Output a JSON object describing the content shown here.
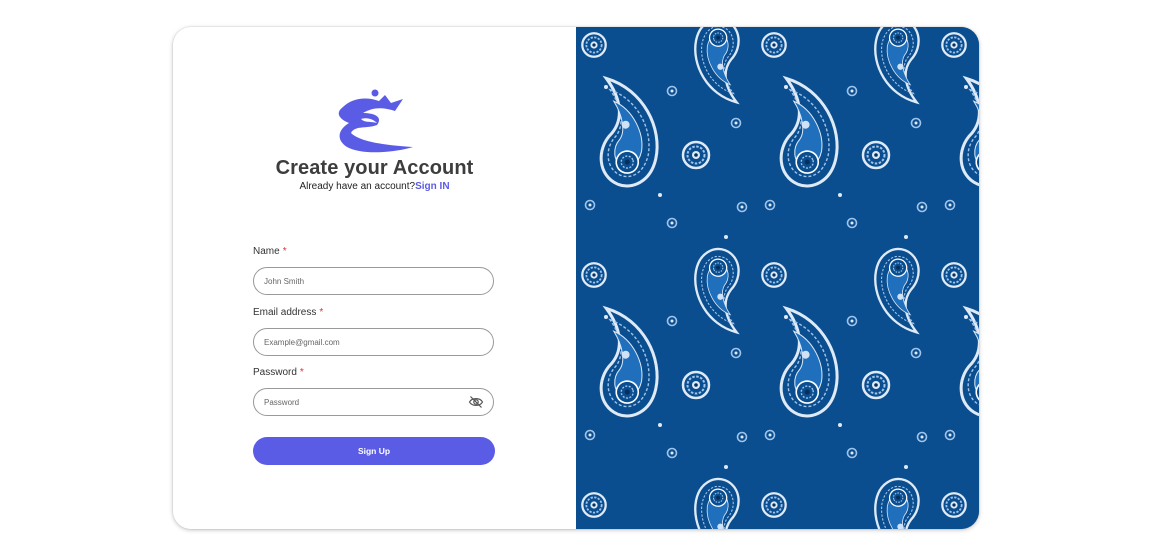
{
  "signup": {
    "title": "Create your Account",
    "subtitle_text": "Already have an account?",
    "signin_link": "Sign IN",
    "fields": {
      "name": {
        "label": "Name",
        "required_mark": "*",
        "placeholder": "John Smith"
      },
      "email": {
        "label": "Email address",
        "required_mark": "*",
        "placeholder": "Example@gmail.com"
      },
      "password": {
        "label": "Password",
        "required_mark": "*",
        "placeholder": "Password"
      }
    },
    "submit_label": "Sign Up"
  },
  "colors": {
    "accent": "#5b5ce6",
    "required": "#e0312f",
    "pattern_blue": "#0b4e8f",
    "pattern_light": "#9fc4ec"
  },
  "icons": {
    "logo": "brand-logo-icon",
    "password_toggle": "eye-slash-icon",
    "pattern": "paisley-pattern"
  }
}
